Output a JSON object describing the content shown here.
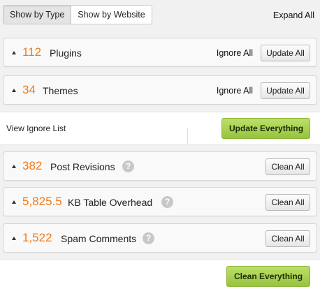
{
  "view_toggle": {
    "by_type": "Show by Type",
    "by_website": "Show by Website"
  },
  "expand_all": "Expand All",
  "updates": [
    {
      "count": "112",
      "label": "Plugins",
      "ignore": "Ignore All",
      "action": "Update All"
    },
    {
      "count": "34",
      "label": "Themes",
      "ignore": "Ignore All",
      "action": "Update All"
    }
  ],
  "update_bar": {
    "view_ignore_list": "View Ignore List",
    "update_everything": "Update Everything"
  },
  "cleanup": [
    {
      "count": "382",
      "label": "Post Revisions",
      "help": "?",
      "action": "Clean All"
    },
    {
      "count": "5,825.5",
      "label": "KB Table Overhead",
      "help": "?",
      "action": "Clean All"
    },
    {
      "count": "1,522",
      "label": "Spam Comments",
      "help": "?",
      "action": "Clean All"
    }
  ],
  "clean_everything": "Clean Everything",
  "colors": {
    "count_orange": "#f07a1b",
    "green_button": "#a8d152"
  }
}
